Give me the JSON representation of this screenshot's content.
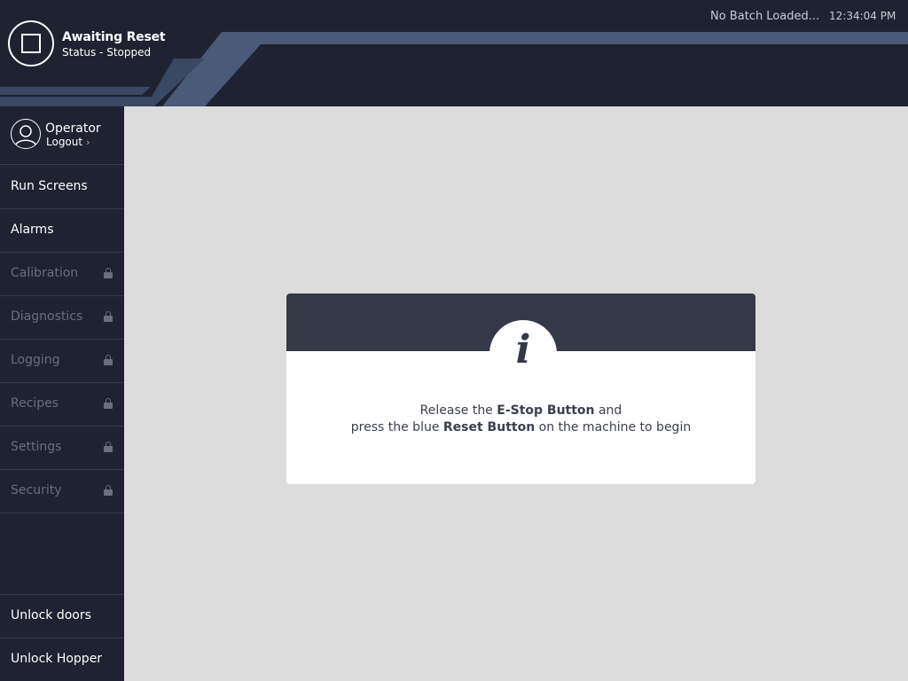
{
  "header": {
    "status_title": "Awaiting Reset",
    "status_subtitle": "Status - Stopped",
    "batch": "No Batch Loaded...",
    "time": "12:34:04 PM",
    "icon": "stop-square-icon"
  },
  "user": {
    "name": "Operator",
    "logout_label": "Logout",
    "chevron": "›",
    "icon": "user-avatar-icon"
  },
  "nav": {
    "items": [
      {
        "label": "Run Screens",
        "locked": false
      },
      {
        "label": "Alarms",
        "locked": false
      },
      {
        "label": "Calibration",
        "locked": true
      },
      {
        "label": "Diagnostics",
        "locked": true
      },
      {
        "label": "Logging",
        "locked": true
      },
      {
        "label": "Recipes",
        "locked": true
      },
      {
        "label": "Settings",
        "locked": true
      },
      {
        "label": "Security",
        "locked": true
      }
    ],
    "bottom": [
      {
        "label": "Unlock doors"
      },
      {
        "label": "Unlock Hopper"
      }
    ]
  },
  "dialog": {
    "icon_glyph": "i",
    "line1_pre": "Release the ",
    "line1_bold": "E-Stop Button",
    "line1_post": " and",
    "line2_pre": "press the blue ",
    "line2_bold": "Reset Button",
    "line2_post": " on the machine to begin"
  },
  "colors": {
    "header_bg": "#1f2230",
    "accent_band": "#4a5a78",
    "content_bg": "#dcdcdc",
    "dialog_head": "#353846",
    "disabled_text": "#6a6f7d"
  }
}
